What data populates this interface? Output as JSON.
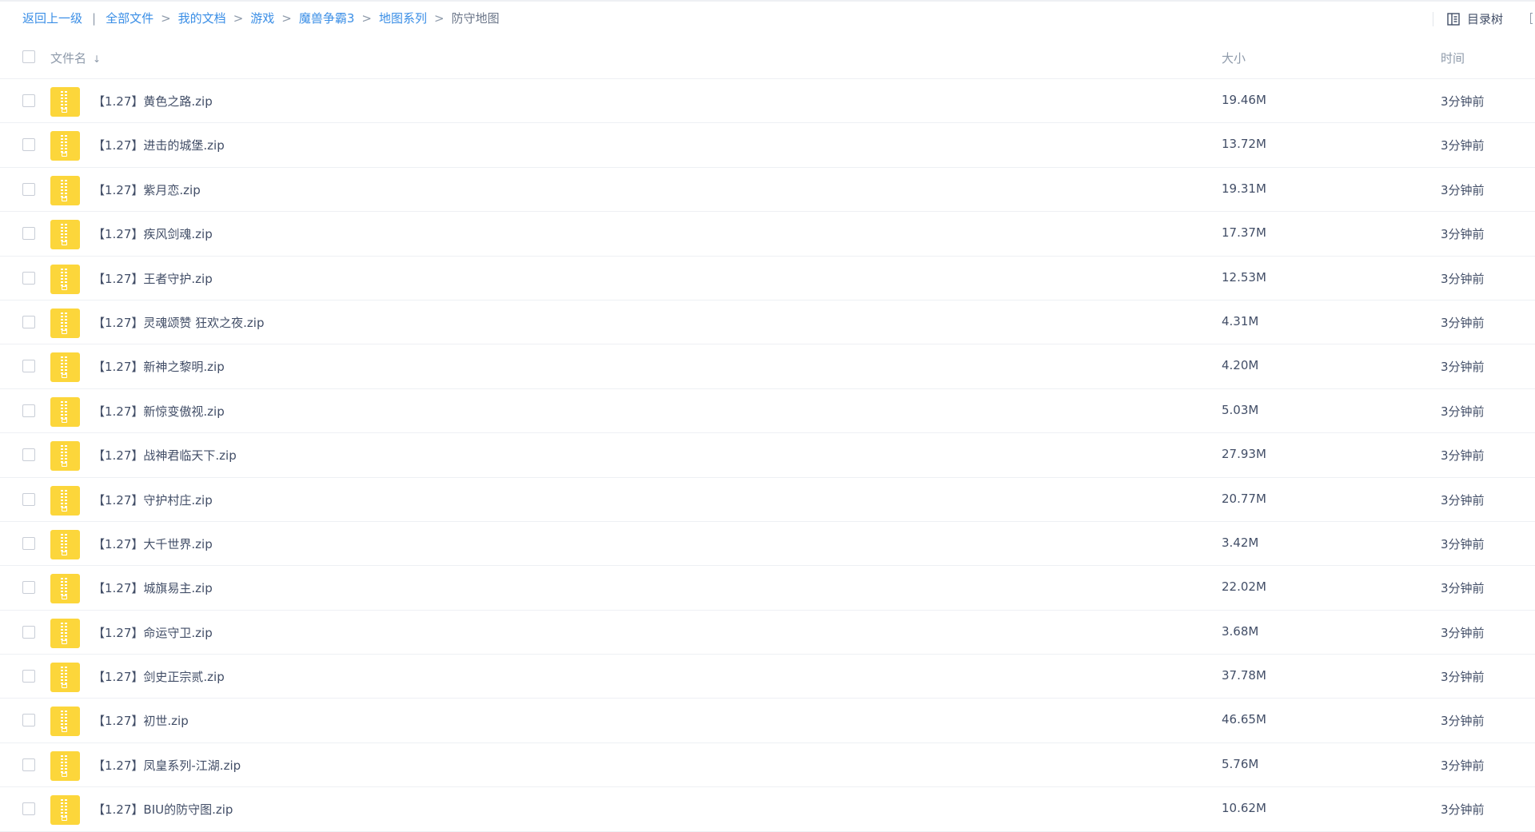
{
  "breadcrumb": {
    "back": "返回上一级",
    "pipe": "|",
    "separator": ">",
    "items": [
      "全部文件",
      "我的文档",
      "游戏",
      "魔兽争霸3",
      "地图系列"
    ],
    "current": "防守地图"
  },
  "toolbar": {
    "tree_label": "目录树",
    "tree_icon": "directory-tree-icon"
  },
  "table": {
    "headers": {
      "name": "文件名",
      "sort_arrow": "↓",
      "size": "大小",
      "time": "时间"
    },
    "rows": [
      {
        "name": "【1.27】黄色之路.zip",
        "size": "19.46M",
        "time": "3分钟前"
      },
      {
        "name": "【1.27】进击的城堡.zip",
        "size": "13.72M",
        "time": "3分钟前"
      },
      {
        "name": "【1.27】紫月恋.zip",
        "size": "19.31M",
        "time": "3分钟前"
      },
      {
        "name": "【1.27】疾风剑魂.zip",
        "size": "17.37M",
        "time": "3分钟前"
      },
      {
        "name": "【1.27】王者守护.zip",
        "size": "12.53M",
        "time": "3分钟前"
      },
      {
        "name": "【1.27】灵魂颂赞 狂欢之夜.zip",
        "size": "4.31M",
        "time": "3分钟前"
      },
      {
        "name": "【1.27】新神之黎明.zip",
        "size": "4.20M",
        "time": "3分钟前"
      },
      {
        "name": "【1.27】新惊变傲视.zip",
        "size": "5.03M",
        "time": "3分钟前"
      },
      {
        "name": "【1.27】战神君临天下.zip",
        "size": "27.93M",
        "time": "3分钟前"
      },
      {
        "name": "【1.27】守护村庄.zip",
        "size": "20.77M",
        "time": "3分钟前"
      },
      {
        "name": "【1.27】大千世界.zip",
        "size": "3.42M",
        "time": "3分钟前"
      },
      {
        "name": "【1.27】城旗易主.zip",
        "size": "22.02M",
        "time": "3分钟前"
      },
      {
        "name": "【1.27】命运守卫.zip",
        "size": "3.68M",
        "time": "3分钟前"
      },
      {
        "name": "【1.27】剑史正宗贰.zip",
        "size": "37.78M",
        "time": "3分钟前"
      },
      {
        "name": "【1.27】初世.zip",
        "size": "46.65M",
        "time": "3分钟前"
      },
      {
        "name": "【1.27】凤皇系列-江湖.zip",
        "size": "5.76M",
        "time": "3分钟前"
      },
      {
        "name": "【1.27】BIU的防守图.zip",
        "size": "10.62M",
        "time": "3分钟前"
      }
    ]
  },
  "colors": {
    "link": "#3a8ee6",
    "zip_icon": "#fcd63b",
    "text": "#424e67",
    "muted": "#8e9aaa",
    "divider": "#eef0f4"
  }
}
